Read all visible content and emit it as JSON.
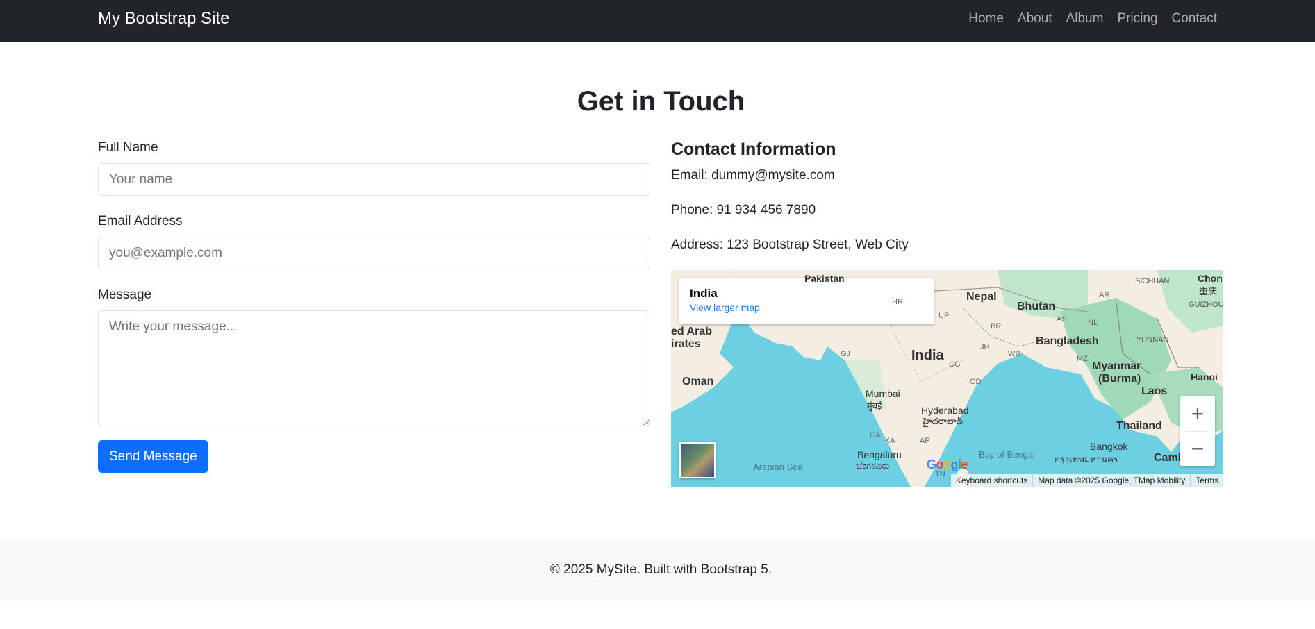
{
  "navbar": {
    "brand": "My Bootstrap Site",
    "links": [
      "Home",
      "About",
      "Album",
      "Pricing",
      "Contact"
    ]
  },
  "page_title": "Get in Touch",
  "form": {
    "name_label": "Full Name",
    "name_placeholder": "Your name",
    "email_label": "Email Address",
    "email_placeholder": "you@example.com",
    "message_label": "Message",
    "message_placeholder": "Write your message...",
    "submit_label": "Send Message"
  },
  "contact": {
    "title": "Contact Information",
    "email": "Email: dummy@mysite.com",
    "phone": "Phone: 91 934 456 7890",
    "address": "Address: 123 Bootstrap Street, Web City"
  },
  "map": {
    "card_title": "India",
    "card_link": "View larger map",
    "zoom_in": "+",
    "zoom_out": "−",
    "labels": {
      "pakistan": "Pakistan",
      "nepal": "Nepal",
      "bhutan": "Bhutan",
      "sichuan": "SICHUAN",
      "chongqing": "Chon",
      "chongqing_local": "重庆",
      "guizhou": "GUIZHOU",
      "uae": "ed Arab",
      "uae2": "irates",
      "bangladesh": "Bangladesh",
      "yunnan": "YUNNAN",
      "india": "India",
      "myanmar": "Myanmar",
      "burma": "(Burma)",
      "hanoi": "Hanoi",
      "oman": "Oman",
      "mumbai": "Mumbai",
      "mumbai_local": "मुंबई",
      "laos": "Laos",
      "hyderabad": "Hyderabad",
      "hyderabad_local": "హైదరాబాద్",
      "thailand": "Thailand",
      "bangkok": "Bangkok",
      "bangkok_local": "กรุงเทพมหานคร",
      "cambodia": "Camb",
      "arabian_sea": "Arabian Sea",
      "bengaluru": "Bengaluru",
      "bengaluru_local": "ಬೆಂಗಳೂರು",
      "bay_of_bengal": "Bay of Bengal",
      "google": "Google",
      "states": [
        "GJ",
        "HR",
        "UP",
        "BR",
        "JH",
        "WB",
        "OD",
        "CG",
        "GA",
        "KA",
        "AP",
        "TN",
        "AS",
        "NL",
        "MZ",
        "AR"
      ]
    },
    "attribution": [
      "Keyboard shortcuts",
      "Map data ©2025 Google, TMap Mobility",
      "Terms"
    ],
    "colors": {
      "water": "#6ccfe2",
      "land": "#f3ede2",
      "green": "#9fd9b6"
    }
  },
  "footer": "© 2025 MySite. Built with Bootstrap 5."
}
